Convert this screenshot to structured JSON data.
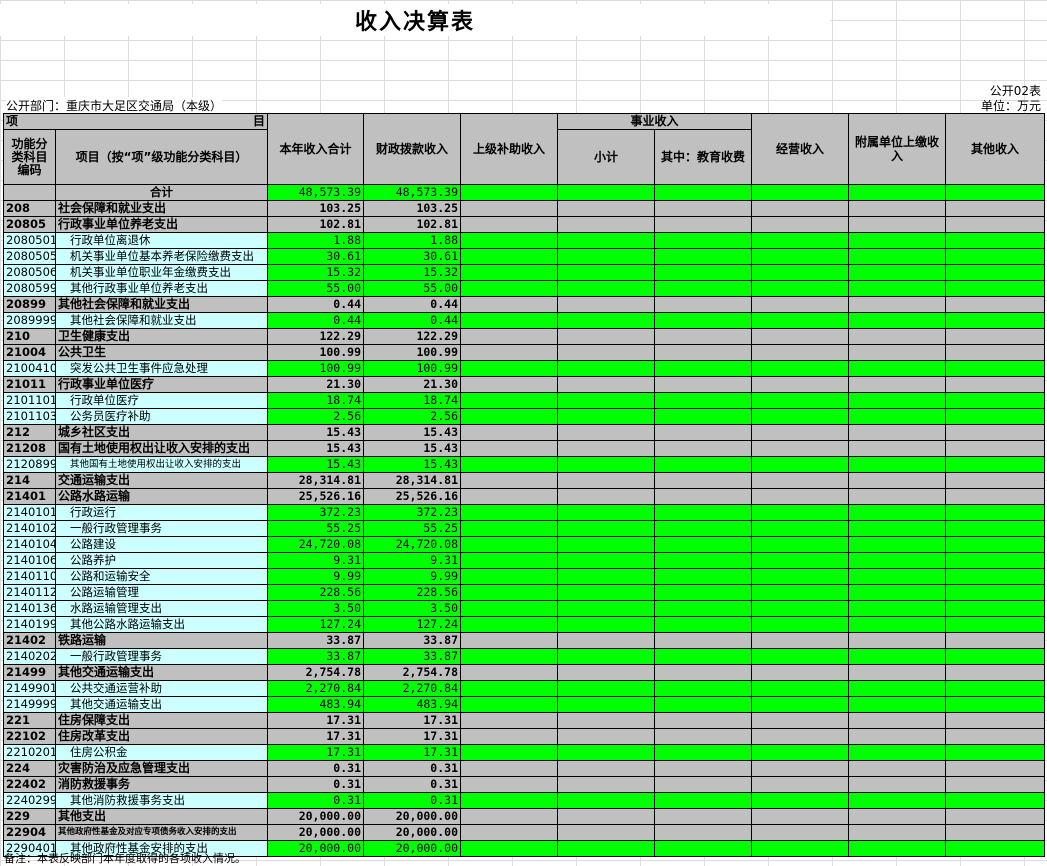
{
  "title": "收入决算表",
  "form_code": "公开02表",
  "department": "公开部门：重庆市大足区交通局（本级）",
  "unit": "单位：万元",
  "header": {
    "item_left": "项",
    "item_right": "目",
    "code": "功能分类科目编码",
    "name": "项目（按“项”级功能分类科目）",
    "total": "本年收入合计",
    "fiscal": "财政拨款收入",
    "superior": "上级补助收入",
    "business": "事业收入",
    "subtotal": "小计",
    "edu": "其中：教育收费",
    "operating": "经营收入",
    "affiliated": "附属单位上缴收入",
    "other": "其他收入"
  },
  "rows": [
    {
      "code": "",
      "name": "合计",
      "total": "48,573.39",
      "fiscal": "48,573.39",
      "level": 0
    },
    {
      "code": "208",
      "name": "社会保障和就业支出",
      "total": "103.25",
      "fiscal": "103.25",
      "level": 1,
      "small": true
    },
    {
      "code": "20805",
      "name": "行政事业单位养老支出",
      "total": "102.81",
      "fiscal": "102.81",
      "level": 1,
      "small": true
    },
    {
      "code": "2080501",
      "name": "行政单位离退休",
      "total": "1.88",
      "fiscal": "1.88",
      "level": 2
    },
    {
      "code": "2080505",
      "name": "机关事业单位基本养老保险缴费支出",
      "total": "30.61",
      "fiscal": "30.61",
      "level": 2
    },
    {
      "code": "2080506",
      "name": "机关事业单位职业年金缴费支出",
      "total": "15.32",
      "fiscal": "15.32",
      "level": 2
    },
    {
      "code": "2080599",
      "name": "其他行政事业单位养老支出",
      "total": "55.00",
      "fiscal": "55.00",
      "level": 2
    },
    {
      "code": "20899",
      "name": "其他社会保障和就业支出",
      "total": "0.44",
      "fiscal": "0.44",
      "level": 1
    },
    {
      "code": "2089999",
      "name": "其他社会保障和就业支出",
      "total": "0.44",
      "fiscal": "0.44",
      "level": 2
    },
    {
      "code": "210",
      "name": "卫生健康支出",
      "total": "122.29",
      "fiscal": "122.29",
      "level": 1
    },
    {
      "code": "21004",
      "name": "公共卫生",
      "total": "100.99",
      "fiscal": "100.99",
      "level": 1
    },
    {
      "code": "2100410",
      "name": "突发公共卫生事件应急处理",
      "total": "100.99",
      "fiscal": "100.99",
      "level": 2
    },
    {
      "code": "21011",
      "name": "行政事业单位医疗",
      "total": "21.30",
      "fiscal": "21.30",
      "level": 1
    },
    {
      "code": "2101101",
      "name": "行政单位医疗",
      "total": "18.74",
      "fiscal": "18.74",
      "level": 2
    },
    {
      "code": "2101103",
      "name": "公务员医疗补助",
      "total": "2.56",
      "fiscal": "2.56",
      "level": 2
    },
    {
      "code": "212",
      "name": "城乡社区支出",
      "total": "15.43",
      "fiscal": "15.43",
      "level": 1,
      "small": true
    },
    {
      "code": "21208",
      "name": "国有土地使用权出让收入安排的支出",
      "total": "15.43",
      "fiscal": "15.43",
      "level": 1,
      "small": true
    },
    {
      "code": "2120899",
      "name": "其他国有土地使用权出让收入安排的支出",
      "total": "15.43",
      "fiscal": "15.43",
      "level": 2,
      "small": true
    },
    {
      "code": "214",
      "name": "交通运输支出",
      "total": "28,314.81",
      "fiscal": "28,314.81",
      "level": 1
    },
    {
      "code": "21401",
      "name": "公路水路运输",
      "total": "25,526.16",
      "fiscal": "25,526.16",
      "level": 1
    },
    {
      "code": "2140101",
      "name": "行政运行",
      "total": "372.23",
      "fiscal": "372.23",
      "level": 2
    },
    {
      "code": "2140102",
      "name": "一般行政管理事务",
      "total": "55.25",
      "fiscal": "55.25",
      "level": 2
    },
    {
      "code": "2140104",
      "name": "公路建设",
      "total": "24,720.08",
      "fiscal": "24,720.08",
      "level": 2
    },
    {
      "code": "2140106",
      "name": "公路养护",
      "total": "9.31",
      "fiscal": "9.31",
      "level": 2
    },
    {
      "code": "2140110",
      "name": "公路和运输安全",
      "total": "9.99",
      "fiscal": "9.99",
      "level": 2
    },
    {
      "code": "2140112",
      "name": "公路运输管理",
      "total": "228.56",
      "fiscal": "228.56",
      "level": 2
    },
    {
      "code": "2140136",
      "name": "水路运输管理支出",
      "total": "3.50",
      "fiscal": "3.50",
      "level": 2
    },
    {
      "code": "2140199",
      "name": "其他公路水路运输支出",
      "total": "127.24",
      "fiscal": "127.24",
      "level": 2
    },
    {
      "code": "21402",
      "name": "铁路运输",
      "total": "33.87",
      "fiscal": "33.87",
      "level": 1
    },
    {
      "code": "2140202",
      "name": "一般行政管理事务",
      "total": "33.87",
      "fiscal": "33.87",
      "level": 2
    },
    {
      "code": "21499",
      "name": "其他交通运输支出",
      "total": "2,754.78",
      "fiscal": "2,754.78",
      "level": 1
    },
    {
      "code": "2149901",
      "name": "公共交通运营补助",
      "total": "2,270.84",
      "fiscal": "2,270.84",
      "level": 2
    },
    {
      "code": "2149999",
      "name": "其他交通运输支出",
      "total": "483.94",
      "fiscal": "483.94",
      "level": 2
    },
    {
      "code": "221",
      "name": "住房保障支出",
      "total": "17.31",
      "fiscal": "17.31",
      "level": 1
    },
    {
      "code": "22102",
      "name": "住房改革支出",
      "total": "17.31",
      "fiscal": "17.31",
      "level": 1
    },
    {
      "code": "2210201",
      "name": "住房公积金",
      "total": "17.31",
      "fiscal": "17.31",
      "level": 2
    },
    {
      "code": "224",
      "name": "灾害防治及应急管理支出",
      "total": "0.31",
      "fiscal": "0.31",
      "level": 1
    },
    {
      "code": "22402",
      "name": "消防救援事务",
      "total": "0.31",
      "fiscal": "0.31",
      "level": 1
    },
    {
      "code": "2240299",
      "name": "其他消防救援事务支出",
      "total": "0.31",
      "fiscal": "0.31",
      "level": 2
    },
    {
      "code": "229",
      "name": "其他支出",
      "total": "20,000.00",
      "fiscal": "20,000.00",
      "level": 1
    },
    {
      "code": "22904",
      "name": "其他政府性基金及对应专项债务收入安排的支出",
      "total": "20,000.00",
      "fiscal": "20,000.00",
      "level": 1,
      "tiny": true
    },
    {
      "code": "2290401",
      "name": "其他政府性基金安排的支出",
      "total": "20,000.00",
      "fiscal": "20,000.00",
      "level": 2
    }
  ],
  "note": "备注：本表反映部门本年度取得的各项收入情况。"
}
